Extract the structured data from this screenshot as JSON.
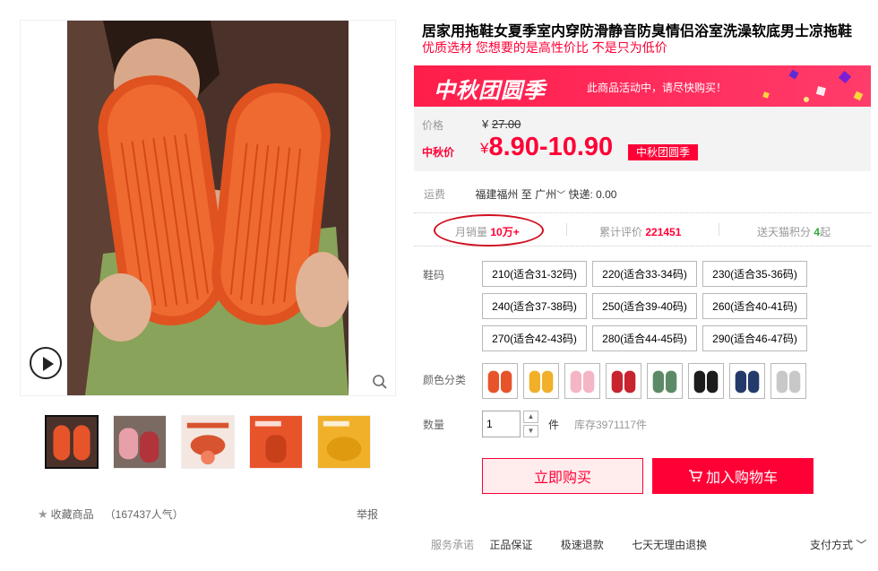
{
  "product": {
    "title": "居家用拖鞋女夏季室内穿防滑静音防臭情侣浴室洗澡软底男士凉拖鞋",
    "subtitle": "优质选材 您想要的是高性价比 不是只为低价"
  },
  "promo": {
    "name": "中秋团圆季",
    "tip": "此商品活动中，请尽快购买！",
    "tag": "中秋团圆季"
  },
  "price": {
    "label": "价格",
    "currency": "¥",
    "original": "27.00",
    "promo_label": "中秋价",
    "promo_price": "8.90-10.90"
  },
  "shipping": {
    "label": "运费",
    "from": "福建福州",
    "to_prefix": "至",
    "to": "广州",
    "fee": "快递: 0.00"
  },
  "stats": {
    "monthly_sales_label": "月销量",
    "monthly_sales": "10万+",
    "reviews_label": "累计评价",
    "reviews": "221451",
    "points_label": "送天猫积分",
    "points": "4",
    "points_suffix": "起"
  },
  "sku": {
    "size_label": "鞋码",
    "sizes": [
      "210(适合31-32码)",
      "220(适合33-34码)",
      "230(适合35-36码)",
      "240(适合37-38码)",
      "250(适合39-40码)",
      "260(适合40-41码)",
      "270(适合42-43码)",
      "280(适合44-45码)",
      "290(适合46-47码)"
    ],
    "color_label": "颜色分类",
    "colors": [
      "#e8542a",
      "#f0b02a",
      "#f4b6c4",
      "#c8232e",
      "#5d8a66",
      "#1c1c1c",
      "#233a6b",
      "#c8c8c8"
    ]
  },
  "quantity": {
    "label": "数量",
    "value": "1",
    "unit": "件",
    "stock": "库存3971117件"
  },
  "actions": {
    "buy": "立即购买",
    "cart": "加入购物车"
  },
  "gallery": {
    "favorite": "收藏商品",
    "popularity": "（167437人气）",
    "report": "举报",
    "thumb_colors": [
      "#e8542a",
      "#e8a0a8",
      "#d8542e",
      "#e8542a",
      "#f0b02a"
    ]
  },
  "service": {
    "label": "服务承诺",
    "items": [
      "正品保证",
      "极速退款",
      "七天无理由退换"
    ],
    "payment": "支付方式"
  },
  "theme": {
    "accent": "#ff0036"
  }
}
